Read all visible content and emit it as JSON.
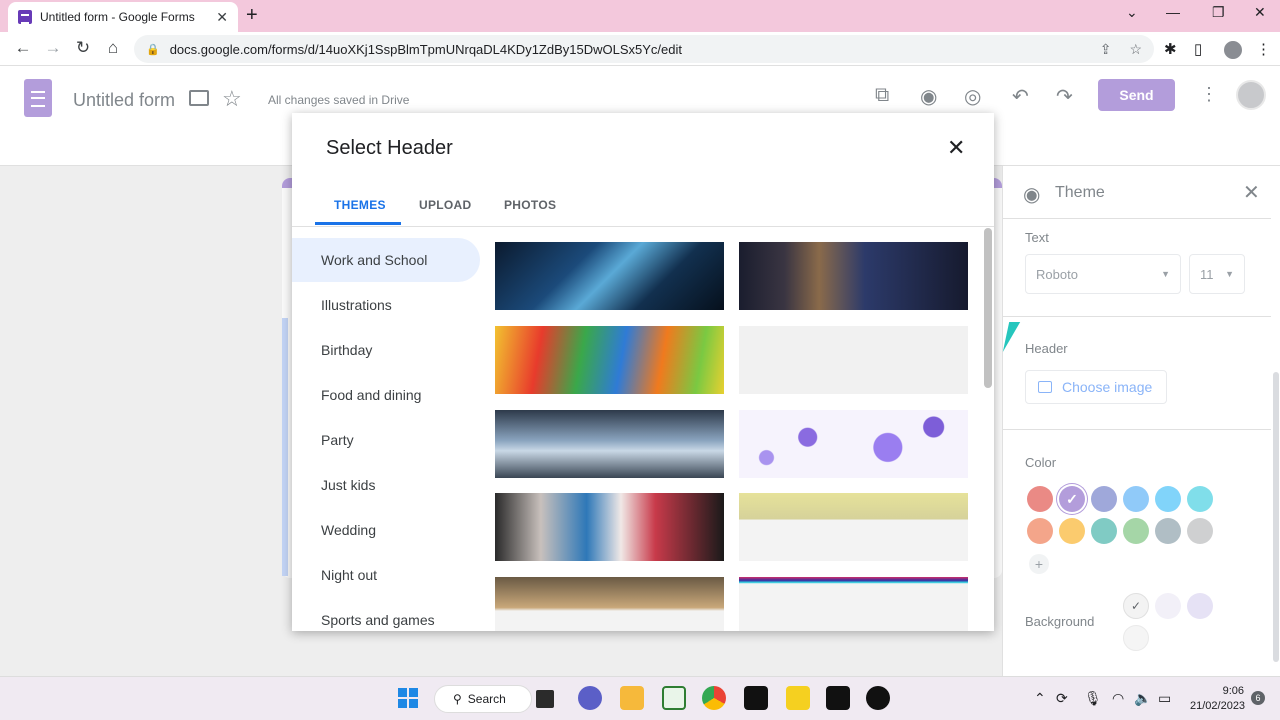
{
  "browser": {
    "tab_title": "Untitled form - Google Forms",
    "tab_close": "✕",
    "new_tab": "+",
    "url": "docs.google.com/forms/d/14uoXKj1SspBlmTpmUNrqaDL4KDy1ZdBy15DwOLSx5Yc/edit",
    "window_controls": [
      "⌄",
      "—",
      "❐",
      "✕"
    ]
  },
  "form_header": {
    "title": "Untitled form",
    "saved_status": "All changes saved in Drive",
    "send_label": "Send"
  },
  "dialog": {
    "title": "Select Header",
    "close": "✕",
    "tabs": [
      "THEMES",
      "UPLOAD",
      "PHOTOS"
    ],
    "active_tab": "THEMES",
    "categories": [
      "Work and School",
      "Illustrations",
      "Birthday",
      "Food and dining",
      "Party",
      "Just kids",
      "Wedding",
      "Night out",
      "Sports and games"
    ],
    "active_category": "Work and School"
  },
  "theme_panel": {
    "title": "Theme",
    "text_label": "Text",
    "font_value": "Roboto",
    "size_value": "11",
    "header_label": "Header",
    "choose_image_label": "Choose image",
    "color_label": "Color",
    "background_label": "Background",
    "colors": [
      "#ea8a85",
      "#b39ddb",
      "#9fa8da",
      "#90caf9",
      "#81d4fa",
      "#80deea",
      "#f4a58a",
      "#fbcb6e",
      "#80cbc4",
      "#a5d6a7",
      "#b0bec5",
      "#cfd0d1"
    ],
    "selected_color": "#b39ddb",
    "backgrounds": [
      "#f3f3f3",
      "#f2f0f8",
      "#e6e2f5",
      "#f5f5f5"
    ]
  },
  "taskbar": {
    "search_label": "Search",
    "time": "9:06",
    "date": "21/02/2023",
    "notification_count": "6"
  }
}
